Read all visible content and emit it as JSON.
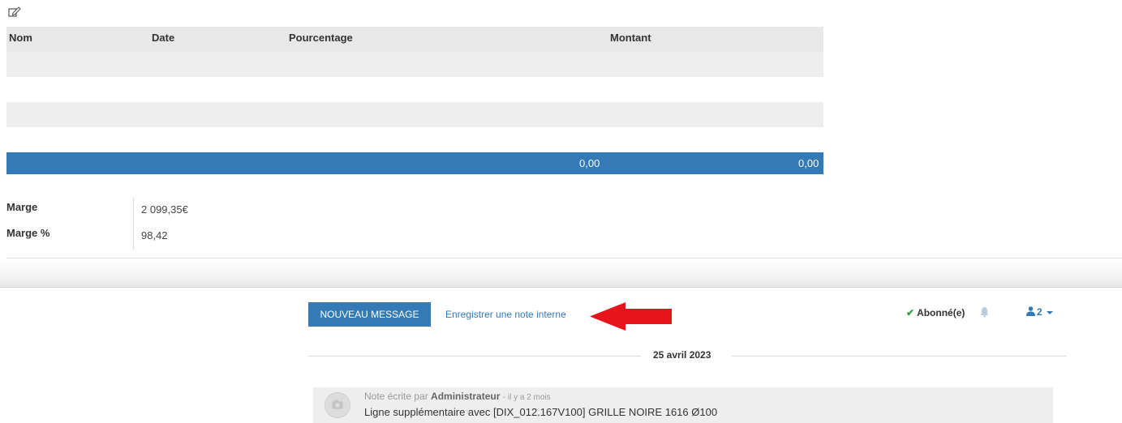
{
  "icons": {
    "edit": "edit-icon",
    "bell": "bell-icon",
    "user": "user-icon",
    "camera": "camera-icon",
    "check": "check-icon"
  },
  "colors": {
    "primary": "#337ab7",
    "row_light": "#eeeeee",
    "header_bg": "#e8e8e8",
    "arrow_red": "#e8141c",
    "check_green": "#2ea043"
  },
  "table": {
    "headers": [
      "Nom",
      "Date",
      "Pourcentage",
      "Montant"
    ],
    "totals": [
      "0,00",
      "0,00"
    ]
  },
  "margins": [
    {
      "label": "Marge",
      "value": "2 099,35€"
    },
    {
      "label": "Marge %",
      "value": "98,42"
    }
  ],
  "chatter": {
    "new_message_label": "NOUVEAU MESSAGE",
    "log_note_label": "Enregistrer une note interne",
    "subscribed_label": "Abonné(e)",
    "followers_count": "2",
    "date_separator": "25 avril 2023",
    "message": {
      "prefix": "Note écrite par",
      "author": "Administrateur",
      "time_ago": "- il y a 2 mois",
      "body": "Ligne supplémentaire avec [DIX_012.167V100] GRILLE NOIRE 1616 Ø100"
    }
  }
}
